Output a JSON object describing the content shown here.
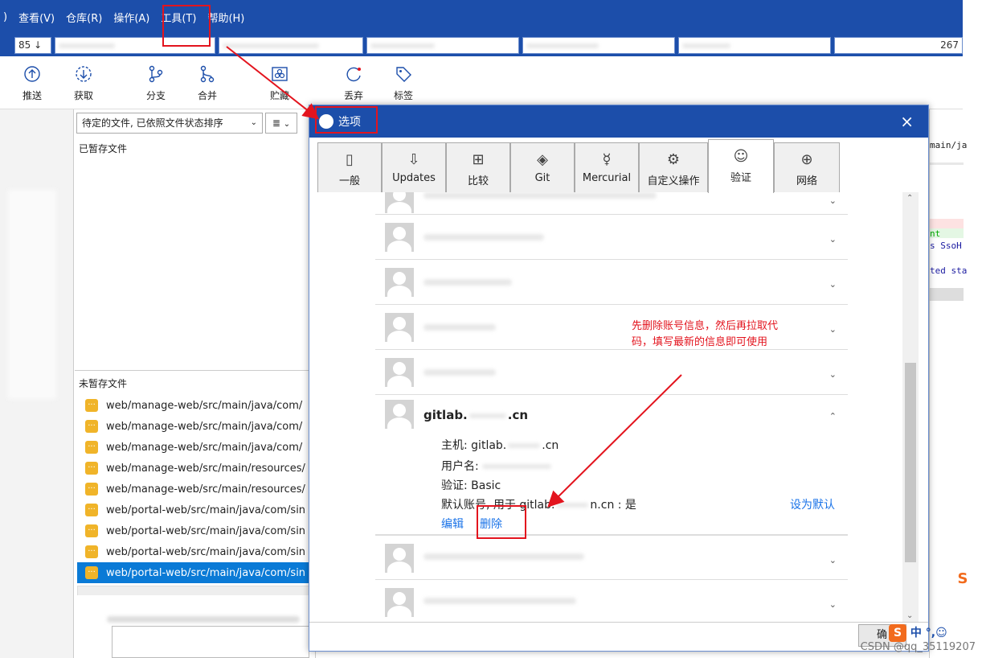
{
  "menu": {
    "items": [
      ")",
      "查看(V)",
      "仓库(R)",
      "操作(A)",
      "工具(T)",
      "帮助(H)"
    ]
  },
  "branchbar": {
    "counter": "85 ↓",
    "right_counter": "267"
  },
  "toolbar": {
    "push": "推送",
    "fetch": "获取",
    "branch": "分支",
    "merge": "合并",
    "stash": "贮藏",
    "discard": "丢弃",
    "tag": "标签"
  },
  "filter": {
    "label": "待定的文件, 已依照文件状态排序",
    "view": "≣"
  },
  "staged": {
    "title": "已暂存文件"
  },
  "unstaged": {
    "title": "未暂存文件",
    "files": [
      "web/manage-web/src/main/java/com/",
      "web/manage-web/src/main/java/com/",
      "web/manage-web/src/main/java/com/",
      "web/manage-web/src/main/resources/",
      "web/manage-web/src/main/resources/",
      "web/portal-web/src/main/java/com/sin",
      "web/portal-web/src/main/java/com/sin",
      "web/portal-web/src/main/java/com/sin",
      "web/portal-web/src/main/java/com/sin"
    ]
  },
  "dialog": {
    "title": "选项",
    "close": "×",
    "tabs": [
      "一般",
      "Updates",
      "比较",
      "Git",
      "Mercurial",
      "自定义操作",
      "验证",
      "网络"
    ],
    "accounts": [
      {
        "name": "gitlab.",
        "name_suffix": ".cn"
      }
    ],
    "expanded": {
      "host_label": "主机:",
      "host_value": "gitlab.",
      "host_suffix": ".cn",
      "user_label": "用户名:",
      "auth_label": "验证:",
      "auth_value": "Basic",
      "default_label": "默认账号, 用于 gitlab.",
      "default_suffix": "n.cn : 是",
      "set_default": "设为默认",
      "edit": "编辑",
      "delete": "删除"
    },
    "ok_button": "确"
  },
  "annotation": "先删除账号信息，然后再拉取代码，填写最新的信息即可使用",
  "right_code": {
    "line1": "main/ja",
    "line2": "nt",
    "line3": "s SsoH",
    "line4": "ted sta"
  },
  "watermark": "CSDN @qq_35119207"
}
